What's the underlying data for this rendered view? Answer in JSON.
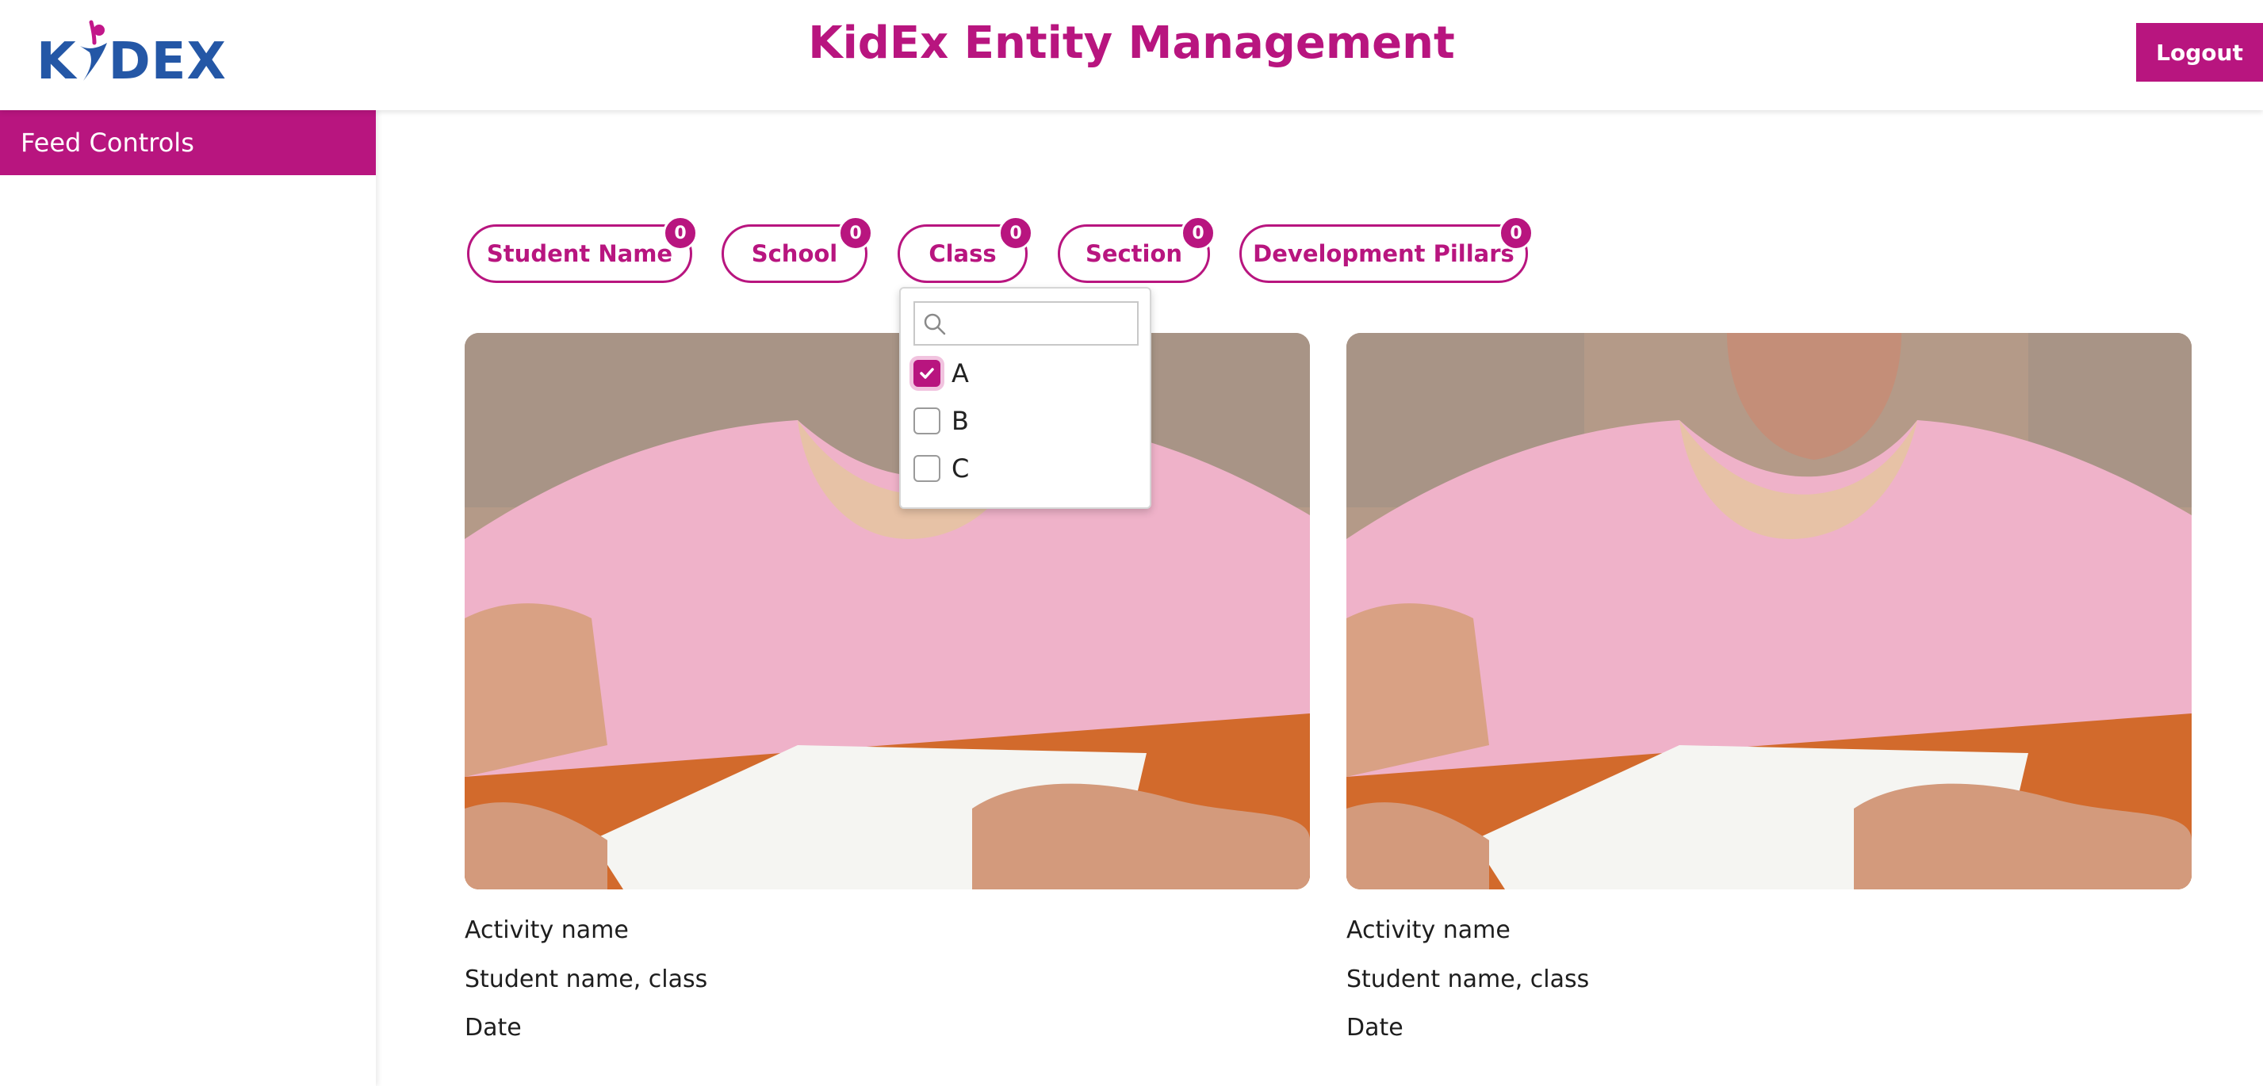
{
  "header": {
    "logo_text": "KIDEX",
    "title": "KidEx Entity Management",
    "logout_label": "Logout"
  },
  "sidebar": {
    "items": [
      {
        "label": "Feed Controls",
        "active": true
      }
    ]
  },
  "filters": [
    {
      "label": "Student Name",
      "count": "0"
    },
    {
      "label": "School",
      "count": "0"
    },
    {
      "label": "Class",
      "count": "0"
    },
    {
      "label": "Section",
      "count": "0"
    },
    {
      "label": "Development Pillars",
      "count": "0"
    }
  ],
  "class_dropdown": {
    "search_placeholder": "",
    "search_icon": "search-icon",
    "options": [
      {
        "label": "A",
        "checked": true
      },
      {
        "label": "B",
        "checked": false
      },
      {
        "label": "C",
        "checked": false
      }
    ]
  },
  "feed": {
    "cards": [
      {
        "activity": "Activity name",
        "student": "Student name, class",
        "date": "Date"
      },
      {
        "activity": "Activity name",
        "student": "Student name, class",
        "date": "Date"
      }
    ]
  },
  "colors": {
    "brand": "#b8157f",
    "logo_blue": "#2457a6",
    "logo_pink": "#c2178a"
  }
}
